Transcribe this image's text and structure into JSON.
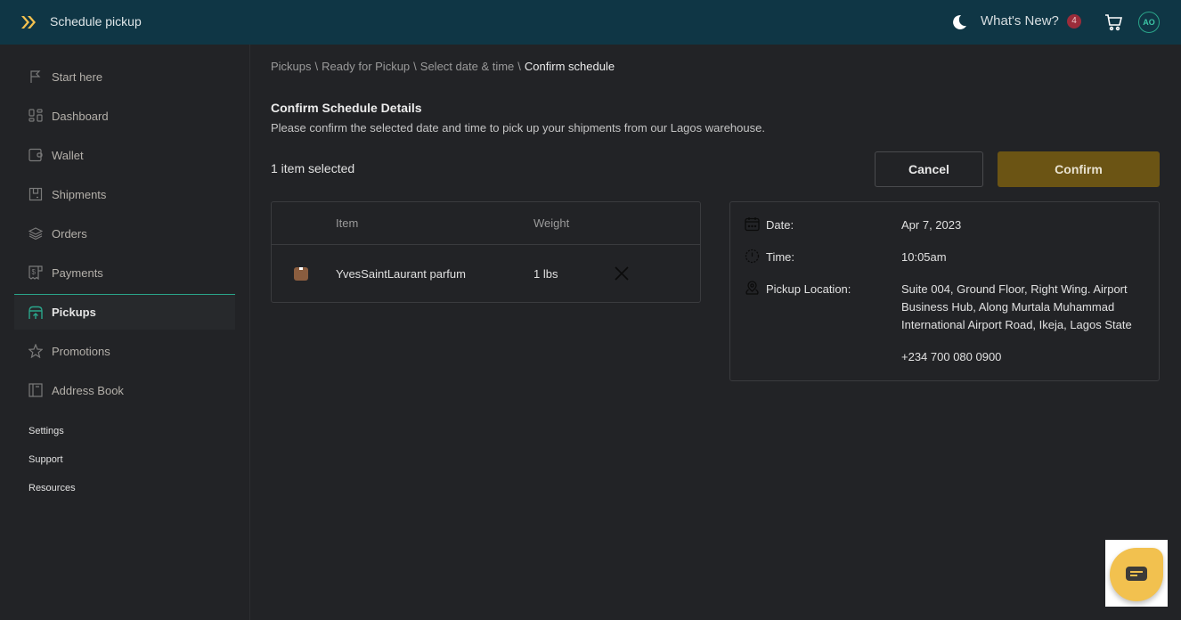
{
  "header": {
    "title": "Schedule pickup",
    "whats_new": "What's New?",
    "whats_new_count": "4",
    "avatar_initials": "AO"
  },
  "sidebar": {
    "items": [
      {
        "label": "Start here",
        "icon": "flag-icon"
      },
      {
        "label": "Dashboard",
        "icon": "dashboard-icon"
      },
      {
        "label": "Wallet",
        "icon": "wallet-icon"
      },
      {
        "label": "Shipments",
        "icon": "shipment-box-icon"
      },
      {
        "label": "Orders",
        "icon": "layers-icon"
      },
      {
        "label": "Payments",
        "icon": "receipt-icon"
      },
      {
        "label": "Pickups",
        "icon": "pickup-store-icon",
        "active": true
      },
      {
        "label": "Promotions",
        "icon": "star-icon"
      },
      {
        "label": "Address Book",
        "icon": "book-icon"
      }
    ],
    "links": [
      "Settings",
      "Support",
      "Resources"
    ]
  },
  "breadcrumb": [
    "Pickups",
    "Ready for Pickup",
    "Select date & time",
    "Confirm schedule"
  ],
  "breadcrumb_separator": "\\",
  "main": {
    "title": "Confirm Schedule Details",
    "description": "Please confirm the selected date and time to pick up your shipments from our Lagos warehouse.",
    "selected_count": "1 item selected",
    "cancel_label": "Cancel",
    "confirm_label": "Confirm"
  },
  "table": {
    "columns": [
      "Item",
      "Weight"
    ],
    "rows": [
      {
        "item": "YvesSaintLaurant parfum",
        "weight": "1 lbs"
      }
    ]
  },
  "details": {
    "date_label": "Date:",
    "date_value": "Apr 7, 2023",
    "time_label": "Time:",
    "time_value": "10:05am",
    "location_label": "Pickup Location:",
    "location_value": "Suite 004, Ground Floor, Right Wing. Airport Business Hub, Along Murtala Muhammad International Airport Road, Ikeja, Lagos State",
    "phone": "+234 700 080 0900"
  },
  "colors": {
    "header_bg": "#0f3645",
    "accent_teal": "#2aa58a",
    "confirm_bg": "#6b5414",
    "badge_bg": "#9b2c3a",
    "chat_bg": "#f2c14f"
  }
}
